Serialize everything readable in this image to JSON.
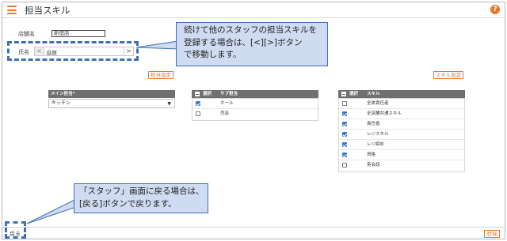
{
  "header": {
    "menu_icon": "hamburger-icon",
    "title": "担当スキル",
    "help_icon": "help-icon",
    "help_glyph": "?"
  },
  "store": {
    "label": "店舗名",
    "value": "新宿店"
  },
  "staff": {
    "label": "氏名",
    "prev_glyph": "<",
    "next_glyph": ">",
    "value": "荻原"
  },
  "callouts": {
    "staff_nav": "続けて他のスタッフの担当スキルを\n登録する場合は、[<][>]ボタン\nで移動します。",
    "back_hint": "「スタッフ」画面に戻る場合は、\n[戻る]ボタンで戻ります。"
  },
  "duty_setting_button": "担当設定",
  "skill_setting_button": "スキル設定",
  "main_duty": {
    "header": "メイン担当*",
    "selected": "キッチン"
  },
  "sub_duty": {
    "col_select": "選択",
    "col_name": "サブ担当",
    "rows": [
      {
        "label": "ホール",
        "checked": true
      },
      {
        "label": "売店",
        "checked": false
      }
    ]
  },
  "skills": {
    "col_select": "選択",
    "col_name": "スキル",
    "rows": [
      {
        "label": "全体責任者",
        "checked": false
      },
      {
        "label": "全店舗共通スキル",
        "checked": true
      },
      {
        "label": "責任者",
        "checked": true
      },
      {
        "label": "レジスキル",
        "checked": true
      },
      {
        "label": "レジ締め",
        "checked": true
      },
      {
        "label": "資格",
        "checked": true
      },
      {
        "label": "英会話",
        "checked": false
      }
    ]
  },
  "footer": {
    "back_label": "戻る",
    "register_label": "登録"
  },
  "colors": {
    "accent": "#e8782b",
    "callout_fill": "#cfdbf0",
    "callout_border": "#3f6fb6",
    "table_header": "#707070",
    "checkbox_on": "#3a78c9"
  }
}
